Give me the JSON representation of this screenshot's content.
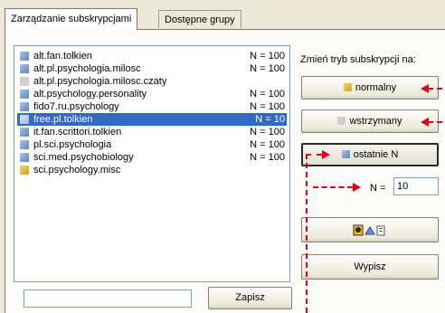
{
  "tabs": [
    {
      "label": "Zarządzanie subskrypcjami",
      "active": true
    },
    {
      "label": "Dostępne grupy",
      "active": false
    }
  ],
  "groups": [
    {
      "name": "alt.fan.tolkien",
      "n": "N = 100",
      "icon": "blue-group-icon"
    },
    {
      "name": "alt.pl.psychologia.milosc",
      "n": "N = 100",
      "icon": "blue-group-icon"
    },
    {
      "name": "alt.pl.psychologia.milosc.czaty",
      "n": "",
      "icon": "gray-group-icon"
    },
    {
      "name": "alt.psychology.personality",
      "n": "N = 100",
      "icon": "blue-group-icon"
    },
    {
      "name": "fido7.ru.psychology",
      "n": "N = 100",
      "icon": "blue-group-icon"
    },
    {
      "name": "free.pl.tolkien",
      "n": "N = 10",
      "icon": "blue-group-icon",
      "selected": true
    },
    {
      "name": "it.fan.scrittori.tolkien",
      "n": "N = 100",
      "icon": "blue-group-icon"
    },
    {
      "name": "pl.sci.psychologia",
      "n": "N = 100",
      "icon": "blue-group-icon"
    },
    {
      "name": "sci.med.psychobiology",
      "n": "N = 100",
      "icon": "blue-group-icon"
    },
    {
      "name": "sci.psychology.misc",
      "n": "",
      "icon": "yellow-group-icon"
    }
  ],
  "side": {
    "mode_label": "Zmień tryb subskrypcji na:",
    "normal": "normalny",
    "suspended": "wstrzymany",
    "last_n": "ostatnie N",
    "n_label": "N =",
    "n_value": "10",
    "print": "Wypisz"
  },
  "bottom": {
    "input_value": "",
    "subscribe": "Zapisz"
  },
  "colors": {
    "selection": "#316ac5",
    "marker": "#e0001a",
    "icon_normal": "#5b86c4",
    "icon_suspended": "#d0d0d0",
    "icon_new": "#d4a01a"
  }
}
